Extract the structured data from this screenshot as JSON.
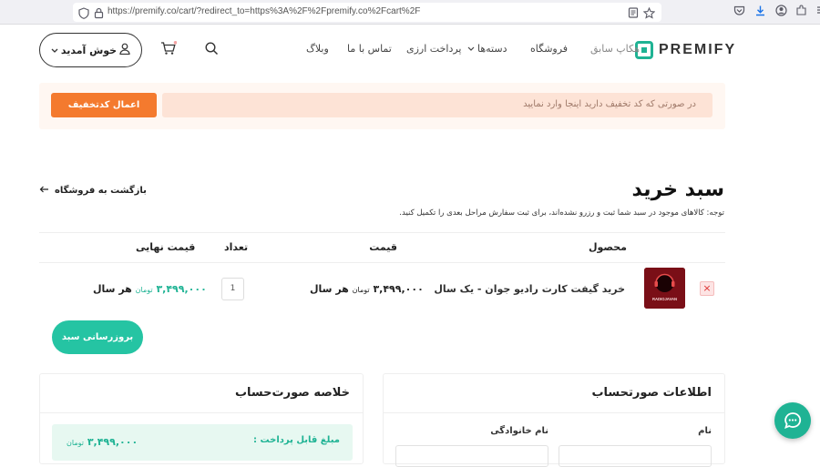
{
  "browser": {
    "url": "https://premify.co/cart/?redirect_to=https%3A%2F%2Fpremify.co%2Fcart%2F"
  },
  "header": {
    "logo_text": "PREMIFY",
    "nav": [
      {
        "label": "هکاپ سابق"
      },
      {
        "label": "فروشگاه"
      },
      {
        "label": "دسته‌ها"
      },
      {
        "label": "پرداخت ارزی"
      },
      {
        "label": "تماس با ما"
      },
      {
        "label": "وبلاگ"
      }
    ],
    "welcome_label": "خوش آمدید"
  },
  "coupon": {
    "placeholder": "در صورتی که کد تخفیف دارید اینجا وارد نمایید",
    "apply_label": "اعمال کدتخفیف"
  },
  "cart": {
    "title": "سبد خرید",
    "back_label": "بازگشت به فروشگاه",
    "note": "توجه: کالاهای موجود در سبد شما ثبت و رزرو نشده‌اند، برای ثبت سفارش مراحل بعدی را تکمیل کنید.",
    "columns": {
      "product": "محصول",
      "price": "قیمت",
      "qty": "تعداد",
      "total": "قیمت نهایی"
    },
    "items": [
      {
        "name": "خرید گیفت کارت رادیو جوان - یک سال",
        "thumb_text": "RADIOJAVAN",
        "price": "۳,۴۹۹,۰۰۰",
        "price_currency": "تومان",
        "price_period": "هر سال",
        "qty": "1",
        "total": "۳,۴۹۹,۰۰۰",
        "total_currency": "تومان",
        "total_period": "هر سال"
      }
    ],
    "update_label": "بروزرسانی سبد خرید"
  },
  "summary": {
    "title": "خلاصه صورت‌حساب",
    "payable_label": "مبلغ قابل پرداخت :",
    "payable_value": "۳,۴۹۹,۰۰۰",
    "payable_currency": "تومان"
  },
  "billing": {
    "title": "اطلاعات صورتحساب",
    "first_name_label": "نام",
    "last_name_label": "نام خانوادگی"
  },
  "colors": {
    "accent": "#1fb394",
    "coupon_button": "#f47a2e",
    "coupon_bg": "#fde3d6"
  },
  "icons": [
    "shield-icon",
    "lock-icon",
    "reader-icon",
    "star-icon",
    "pocket-icon",
    "download-icon",
    "account-icon",
    "extensions-icon",
    "menu-icon",
    "user-icon",
    "cart-icon",
    "search-icon",
    "chevron-down-icon",
    "arrow-left-icon",
    "close-icon",
    "chat-icon"
  ]
}
